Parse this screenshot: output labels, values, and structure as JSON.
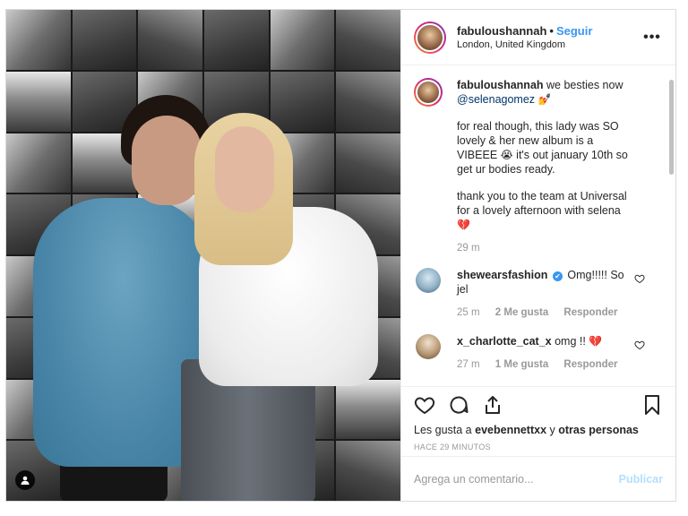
{
  "header": {
    "username": "fabuloushannah",
    "separator": "•",
    "follow_label": "Seguir",
    "location": "London, United Kingdom",
    "more_label": "•••"
  },
  "caption": {
    "username": "fabuloushannah",
    "text1": "we besties now",
    "mention": "@selenagomez",
    "emoji1": "💅",
    "para2": "for real though, this lady was SO lovely & her new album is a VIBEEE",
    "emoji2": "😭",
    "para2b": "it's out january 10th so get ur bodies ready.",
    "para3": "thank you to the team at Universal for a lovely afternoon with selena",
    "emoji3": "💔",
    "time": "29 m"
  },
  "comments": [
    {
      "username": "shewearsfashion",
      "verified": "✔",
      "text": "Omg!!!!! So jel",
      "time": "25 m",
      "likes": "2 Me gusta",
      "reply": "Responder"
    },
    {
      "username": "x_charlotte_cat_x",
      "text": "omg !!",
      "emoji": "💔",
      "time": "27 m",
      "likes": "1 Me gusta",
      "reply": "Responder"
    }
  ],
  "actions": {
    "likes_prefix": "Les gusta a",
    "likes_user": "evebennettxx",
    "likes_joiner": "y",
    "likes_others": "otras personas",
    "timestamp": "Hace 29 minutos"
  },
  "add_comment": {
    "placeholder": "Agrega un comentario...",
    "post_label": "Publicar"
  },
  "colors": {
    "accent": "#3897f0",
    "post_disabled": "#b2dffc",
    "muted": "#999999",
    "border": "#dbdbdb"
  },
  "icons": [
    "heart-icon",
    "comment-icon",
    "share-icon",
    "bookmark-icon",
    "more-icon",
    "user-tag-icon",
    "verified-icon"
  ]
}
